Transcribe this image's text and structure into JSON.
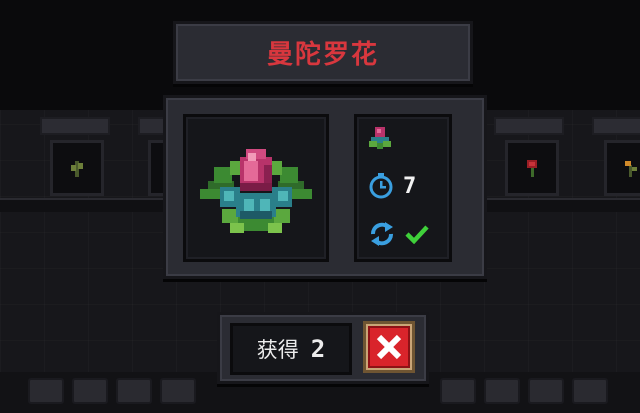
{
  "title": "曼陀罗花",
  "info": {
    "seed_icon": "seed-icon",
    "time_icon": "stopwatch-icon",
    "time_value": "7",
    "repeat_icon": "cycle-icon",
    "repeat_status_icon": "check-icon"
  },
  "reward": {
    "label": "获得",
    "count": "2"
  },
  "close_icon": "close-icon",
  "colors": {
    "title": "#d8373e",
    "panel": "#2b2c33",
    "inset": "#15161a",
    "close_red": "#d9242b",
    "close_frame": "#c9a577",
    "check": "#3fd03a",
    "cycle": "#3a9fe0"
  }
}
